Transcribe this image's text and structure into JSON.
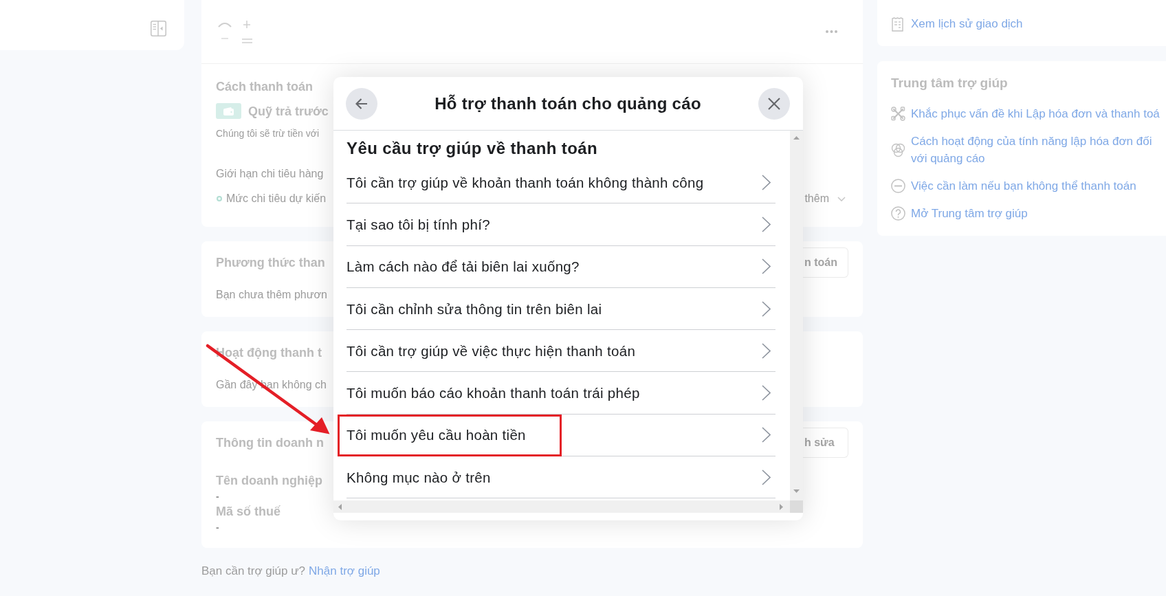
{
  "main": {
    "payment_method": {
      "title": "Cách thanh toán",
      "method": "Quỹ trả trước",
      "description": "Chúng tôi sẽ trừ tiền với",
      "spending_limit": "Giới hạn chi tiêu hàng",
      "estimate": "Mức chi tiêu dự kiến",
      "expand": "thêm"
    },
    "cards": [
      {
        "title": "Phương thức than",
        "button": "n toán",
        "text": "Bạn chưa thêm phươn"
      },
      {
        "title": "Hoạt động thanh t",
        "text": "Gần đây bạn không ch"
      },
      {
        "title": "Thông tin doanh n",
        "button": "h sửa",
        "fields": [
          {
            "label": "Tên doanh nghiệp",
            "value": "-"
          },
          {
            "label": "Mã số thuế",
            "value": "-"
          }
        ]
      }
    ],
    "footer": {
      "text": "Bạn cần trợ giúp ư?",
      "link": "Nhận trợ giúp"
    }
  },
  "side_panel": {
    "transactions_link": "Xem lịch sử giao dịch",
    "help_center": {
      "title": "Trung tâm trợ giúp",
      "links": [
        "Khắc phục vấn đề khi Lập hóa đơn và thanh toá",
        "Cách hoạt động của tính năng lập hóa đơn đối với quảng cáo",
        "Việc cần làm nếu bạn không thể thanh toán",
        "Mở Trung tâm trợ giúp"
      ]
    }
  },
  "dialog": {
    "title": "Hỗ trợ thanh toán cho quảng cáo",
    "heading": "Yêu cầu trợ giúp về thanh toán",
    "items": [
      {
        "label": "Tôi cần trợ giúp về khoản thanh toán không thành công",
        "highlighted": false
      },
      {
        "label": "Tại sao tôi bị tính phí?",
        "highlighted": false
      },
      {
        "label": "Làm cách nào để tải biên lai xuống?",
        "highlighted": false
      },
      {
        "label": "Tôi cần chỉnh sửa thông tin trên biên lai",
        "highlighted": false
      },
      {
        "label": "Tôi cần trợ giúp về việc thực hiện thanh toán",
        "highlighted": false
      },
      {
        "label": "Tôi muốn báo cáo khoản thanh toán trái phép",
        "highlighted": false
      },
      {
        "label": "Tôi muốn yêu cầu hoàn tiền",
        "highlighted": true
      },
      {
        "label": "Không mục nào ở trên",
        "highlighted": false
      }
    ]
  }
}
